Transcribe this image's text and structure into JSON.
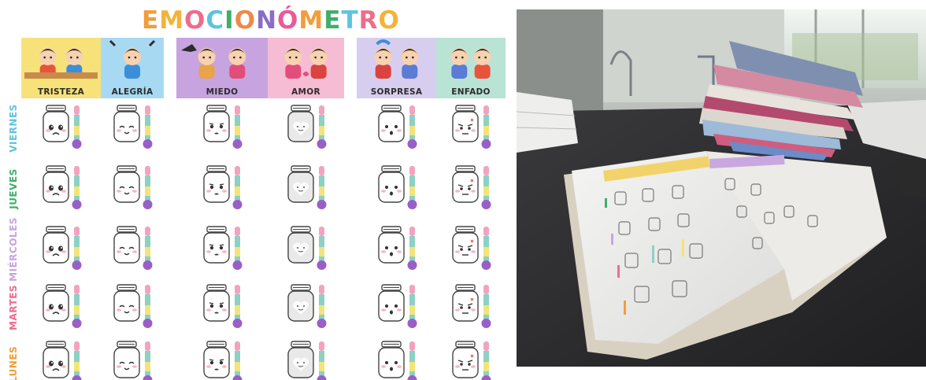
{
  "sheet": {
    "title_letters": [
      {
        "ch": "E",
        "color": "#f29c3b"
      },
      {
        "ch": "M",
        "color": "#f2b33b"
      },
      {
        "ch": "O",
        "color": "#ee6c8b"
      },
      {
        "ch": "C",
        "color": "#5fc3df"
      },
      {
        "ch": "I",
        "color": "#3fae6a"
      },
      {
        "ch": "O",
        "color": "#ee8a4a"
      },
      {
        "ch": "N",
        "color": "#8b6cc7"
      },
      {
        "ch": "Ó",
        "color": "#e95a9a"
      },
      {
        "ch": "M",
        "color": "#f29c3b"
      },
      {
        "ch": "E",
        "color": "#3fae6a"
      },
      {
        "ch": "T",
        "color": "#5fc3df"
      },
      {
        "ch": "R",
        "color": "#ee6c8b"
      },
      {
        "ch": "O",
        "color": "#f2b33b"
      }
    ],
    "emotions": [
      {
        "label": "TRISTEZA",
        "bg": "#f7e27a",
        "icon": "sad-kids-icon",
        "face": "sad"
      },
      {
        "label": "ALEGRÍA",
        "bg": "#a7d9f3",
        "icon": "happy-kid-icon",
        "face": "happy"
      },
      {
        "label": "MIEDO",
        "bg": "#c7a4e0",
        "icon": "scared-kids-icon",
        "face": "fear"
      },
      {
        "label": "AMOR",
        "bg": "#f6bcd3",
        "icon": "hugging-family-icon",
        "face": "love"
      },
      {
        "label": "SORPRESA",
        "bg": "#d7cdee",
        "icon": "surprised-kids-icon",
        "face": "surprise"
      },
      {
        "label": "ENFADO",
        "bg": "#b9e3d5",
        "icon": "angry-kids-icon",
        "face": "angry"
      }
    ],
    "days": [
      {
        "label": "VIERNES",
        "color": "#5fc3df"
      },
      {
        "label": "JUEVES",
        "color": "#3fae6a"
      },
      {
        "label": "MIÉRCOLES",
        "color": "#c7a4e0"
      },
      {
        "label": "MARTES",
        "color": "#ee6c8b"
      },
      {
        "label": "LUNES",
        "color": "#f29c3b"
      }
    ],
    "thermometer_colors": [
      "#f2a3c0",
      "#8dd1c3",
      "#f2e47a",
      "#9a5fc7"
    ]
  },
  "photo": {
    "icon": "open-notebook-on-desk-photo"
  }
}
